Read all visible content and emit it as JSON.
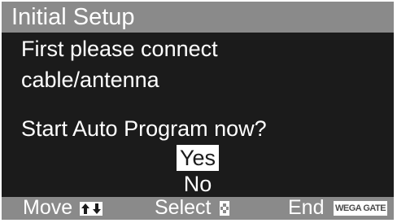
{
  "header": {
    "title": "Initial Setup"
  },
  "message": {
    "line1": "First please connect",
    "line2": "cable/antenna",
    "question": "Start Auto Program now?"
  },
  "options": [
    {
      "label": "Yes",
      "selected": true
    },
    {
      "label": "No",
      "selected": false
    }
  ],
  "footer": {
    "move_label": "Move",
    "move_icon": "up-down-arrows-icon",
    "select_label": "Select",
    "select_icon": "center-button-icon",
    "end_label": "End",
    "end_badge": "WEGA GATE"
  },
  "colors": {
    "background": "#1b1b1b",
    "bar": "#8a8a8a",
    "text": "#ffffff"
  }
}
